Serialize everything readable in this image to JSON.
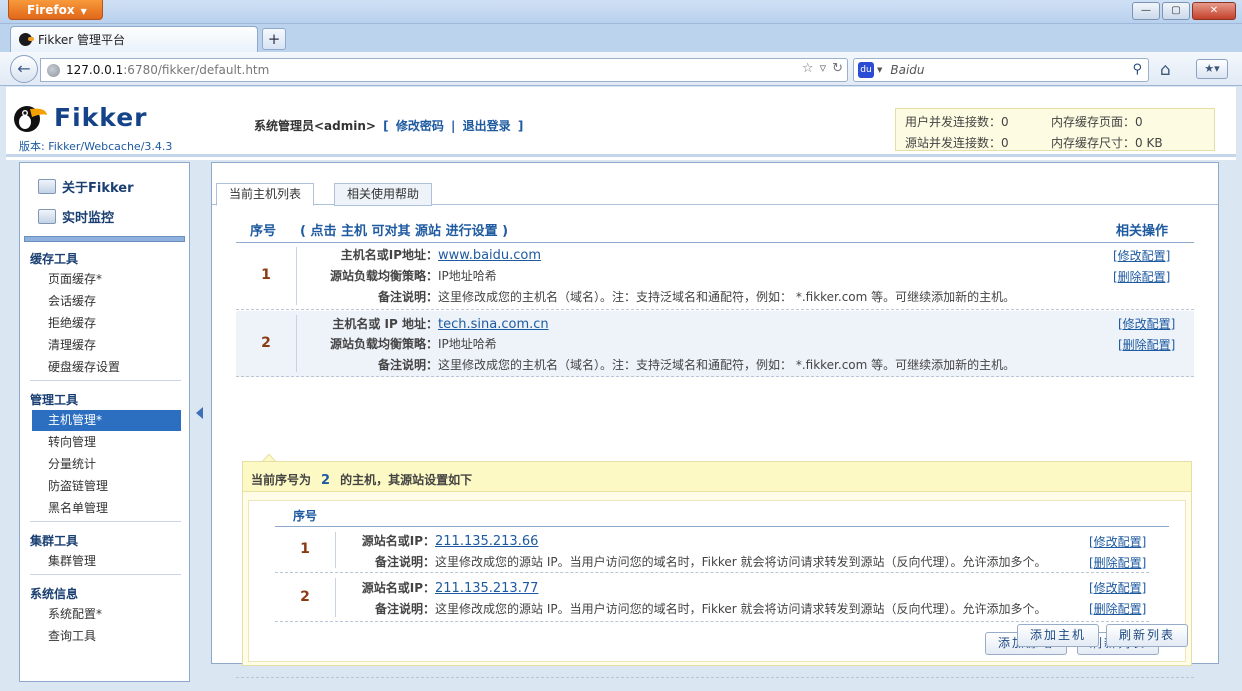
{
  "browser": {
    "app_button": "Firefox",
    "tab_title": "Fikker 管理平台",
    "url_host": "127.0.0.1",
    "url_rest": ":6780/fikker/default.htm",
    "search_placeholder": "Baidu",
    "window_buttons": [
      "—",
      "▢",
      "✕"
    ]
  },
  "header": {
    "logo_text": "Fikker",
    "version_label": "版本: ",
    "version_value": "Fikker/Webcache/3.4.3",
    "user_text": "系统管理员<admin>",
    "bracket_open": "[",
    "change_password": "修改密码",
    "separator": "|",
    "logout": "退出登录",
    "bracket_close": "]",
    "stats": [
      {
        "label": "用户并发连接数：",
        "value": "0"
      },
      {
        "label": "内存缓存页面：",
        "value": "0"
      },
      {
        "label": "源站并发连接数：",
        "value": "0"
      },
      {
        "label": "内存缓存尺寸：",
        "value": "0 KB"
      }
    ]
  },
  "sidebar": {
    "top_items": [
      "关于Fikker",
      "实时监控"
    ],
    "groups": [
      {
        "title": "缓存工具",
        "items": [
          "页面缓存*",
          "会话缓存",
          "拒绝缓存",
          "清理缓存",
          "硬盘缓存设置"
        ]
      },
      {
        "title": "管理工具",
        "items": [
          "主机管理*",
          "转向管理",
          "分量统计",
          "防盗链管理",
          "黑名单管理"
        ]
      },
      {
        "title": "集群工具",
        "items": [
          "集群管理"
        ]
      },
      {
        "title": "系统信息",
        "items": [
          "系统配置*",
          "查询工具"
        ]
      }
    ],
    "active_item": "主机管理*"
  },
  "main": {
    "tabs": [
      "当前主机列表",
      "相关使用帮助"
    ],
    "col_index": "序号",
    "col_desc": "( 点击 主机 可对其 源站 进行设置 )",
    "col_ops": "相关操作",
    "hosts": [
      {
        "index": "1",
        "host_label": "主机名或IP地址：",
        "host_value": "www.baidu.com",
        "lb_label": "源站负载均衡策略：",
        "lb_value": "IP地址哈希",
        "note_label": "备注说明：",
        "note_value": "这里修改成您的主机名（域名）。注：支持泛域名和通配符，例如： *.fikker.com 等。可继续添加新的主机。",
        "edit": "[修改配置]",
        "delete": "[删除配置]"
      },
      {
        "index": "2",
        "host_label": "主机名或 IP 地址：",
        "host_value": "tech.sina.com.cn",
        "lb_label": "源站负载均衡策略：",
        "lb_value": "IP地址哈希",
        "note_label": "备注说明：",
        "note_value": "这里修改成您的主机名（域名）。注：支持泛域名和通配符，例如： *.fikker.com 等。可继续添加新的主机。",
        "edit": "[修改配置]",
        "delete": "[删除配置]"
      }
    ],
    "origin_panel": {
      "head_prefix": "当前序号为",
      "head_num": "2",
      "head_suffix": "的主机，其源站设置如下",
      "col_index": "序号",
      "origins": [
        {
          "index": "1",
          "name_label": "源站名或IP：",
          "name_value": "211.135.213.66",
          "note_label": "备注说明：",
          "note_value": "这里修改成您的源站 IP。当用户访问您的域名时，Fikker 就会将访问请求转发到源站（反向代理）。允许添加多个。",
          "edit": "[修改配置]",
          "delete": "[删除配置]"
        },
        {
          "index": "2",
          "name_label": "源站名或IP：",
          "name_value": "211.135.213.77",
          "note_label": "备注说明：",
          "note_value": "这里修改成您的源站 IP。当用户访问您的域名时，Fikker 就会将访问请求转发到源站（反向代理）。允许添加多个。",
          "edit": "[修改配置]",
          "delete": "[删除配置]"
        }
      ],
      "add_origin": "添加源站",
      "refresh": "刷新列表"
    },
    "add_host": "添加主机",
    "refresh": "刷新列表"
  }
}
